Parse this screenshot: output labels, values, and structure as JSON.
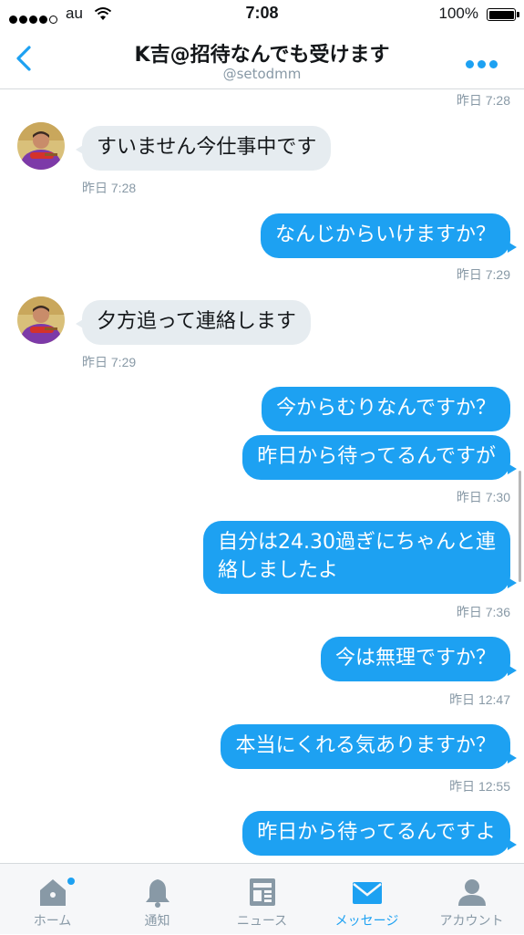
{
  "status_bar": {
    "carrier": "au",
    "time": "7:08",
    "battery": "100%"
  },
  "header": {
    "title": "K吉@招待なんでも受けます",
    "username": "@setodmm"
  },
  "messages": [
    {
      "type": "timestamp",
      "side": "right",
      "time": "昨日 7:28"
    },
    {
      "type": "in",
      "text": "すいません今仕事中です"
    },
    {
      "type": "timestamp",
      "side": "left",
      "time": "昨日 7:28"
    },
    {
      "type": "out",
      "text": "なんじからいけますか？"
    },
    {
      "type": "timestamp",
      "side": "right",
      "time": "昨日 7:29"
    },
    {
      "type": "in",
      "text": "夕方追って連絡します"
    },
    {
      "type": "timestamp",
      "side": "left",
      "time": "昨日 7:29"
    },
    {
      "type": "out",
      "text": "今からむりなんですか？"
    },
    {
      "type": "out",
      "text": "昨日から待ってるんですが"
    },
    {
      "type": "timestamp",
      "side": "right",
      "time": "昨日 7:30"
    },
    {
      "type": "out",
      "text_line1": "自分は24.30過ぎにちゃんと連",
      "text_line2": "絡しましたよ"
    },
    {
      "type": "timestamp",
      "side": "right",
      "time": "昨日 7:36"
    },
    {
      "type": "out",
      "text": "今は無理ですか？"
    },
    {
      "type": "timestamp",
      "side": "right",
      "time": "昨日 12:47"
    },
    {
      "type": "out",
      "text": "本当にくれる気ありますか？"
    },
    {
      "type": "timestamp",
      "side": "right",
      "time": "昨日 12:55"
    },
    {
      "type": "out",
      "text": "昨日から待ってるんですよ"
    }
  ],
  "tabs": [
    {
      "label": "ホーム",
      "icon": "home-icon",
      "active": false,
      "badge": true
    },
    {
      "label": "通知",
      "icon": "bell-icon",
      "active": false
    },
    {
      "label": "ニュース",
      "icon": "news-icon",
      "active": false
    },
    {
      "label": "メッセージ",
      "icon": "envelope-icon",
      "active": true
    },
    {
      "label": "アカウント",
      "icon": "person-icon",
      "active": false
    }
  ],
  "colors": {
    "accent": "#1da1f2",
    "incoming_bubble": "#e6ecf0",
    "muted_text": "#8899a6"
  }
}
